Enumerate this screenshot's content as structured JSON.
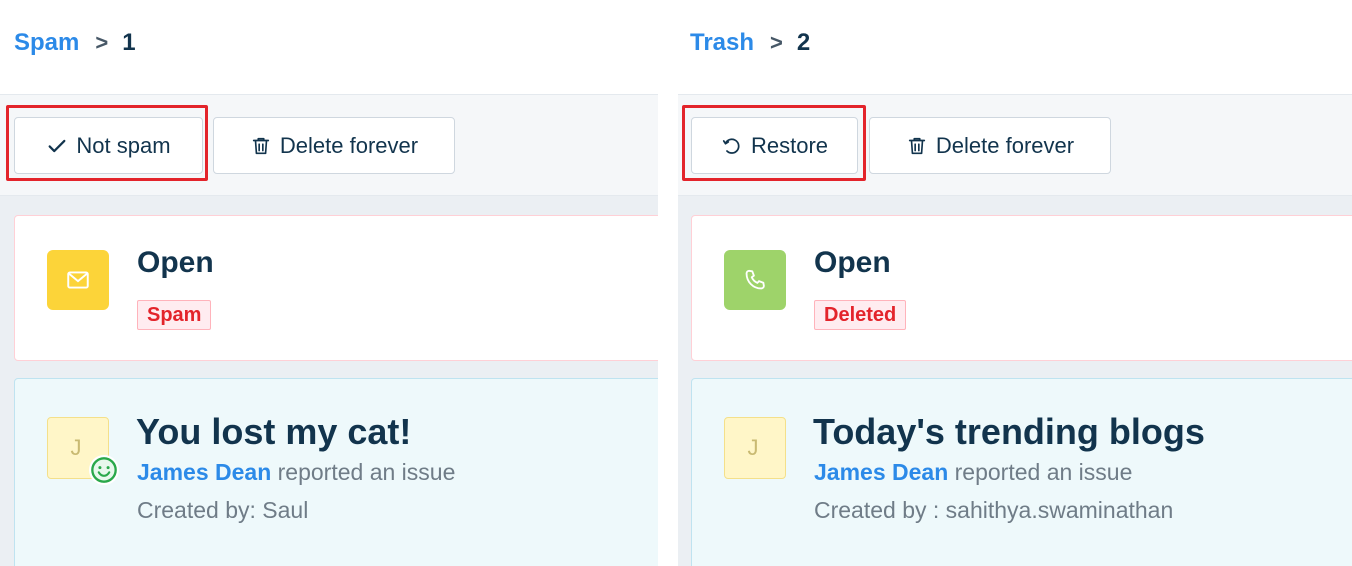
{
  "left": {
    "breadcrumb": {
      "folder": "Spam",
      "separator": ">",
      "count": "1"
    },
    "toolbar": {
      "primary_icon": "check-icon",
      "primary_label": "Not spam",
      "delete_icon": "trash-icon",
      "delete_label": "Delete forever"
    },
    "status_card": {
      "icon": "envelope-icon",
      "icon_bg": "#fcd439",
      "title": "Open",
      "badge": "Spam"
    },
    "ticket": {
      "avatar_letter": "J",
      "avatar_icon": "smile-icon",
      "title": "You lost my cat!",
      "actor": "James Dean",
      "action": " reported an issue",
      "meta": "Created by: Saul"
    }
  },
  "right": {
    "breadcrumb": {
      "folder": "Trash",
      "separator": ">",
      "count": "2"
    },
    "toolbar": {
      "primary_icon": "restore-icon",
      "primary_label": "Restore",
      "delete_icon": "trash-icon",
      "delete_label": "Delete forever"
    },
    "status_card": {
      "icon": "phone-icon",
      "icon_bg": "#9ed36a",
      "title": "Open",
      "badge": "Deleted"
    },
    "ticket": {
      "avatar_letter": "J",
      "title": "Today's trending blogs",
      "actor": "James Dean",
      "action": " reported an issue",
      "meta": "Created by : sahithya.swaminathan"
    }
  },
  "colors": {
    "accent": "#2c8ae8",
    "highlight": "#e3242b",
    "badge_text": "#e3242b",
    "text": "#12344d"
  }
}
